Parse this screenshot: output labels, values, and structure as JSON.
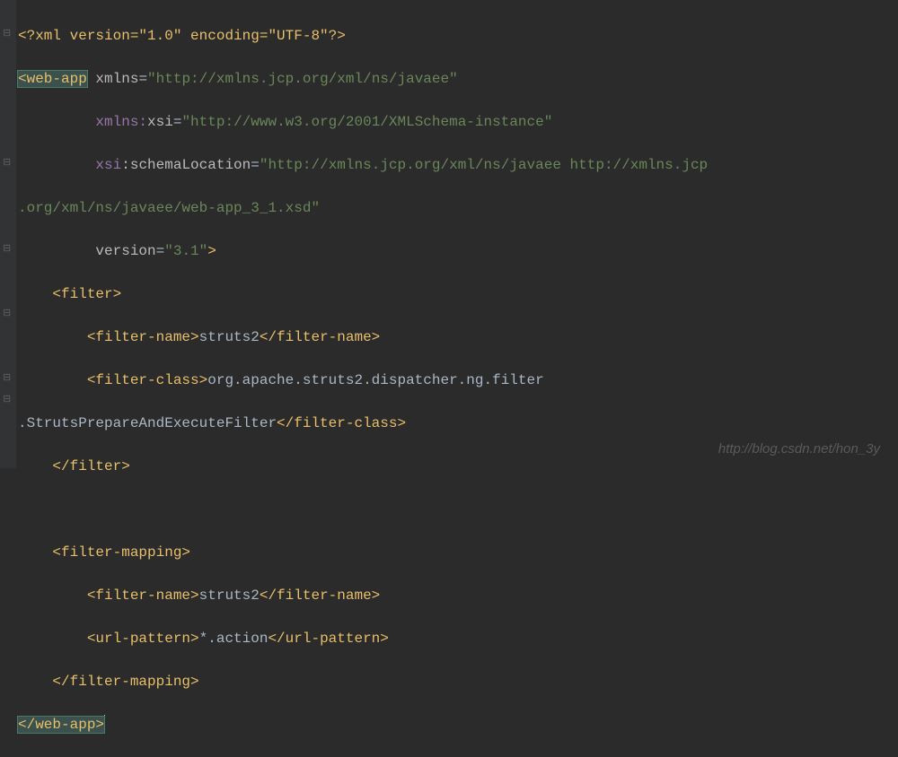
{
  "code": {
    "l1_decl": "<?xml version=\"1.0\" encoding=\"UTF-8\"?>",
    "l2_tag": "<web-app",
    "l2_attr1_name": "xmlns",
    "l2_attr1_val": "\"http://xmlns.jcp.org/xml/ns/javaee\"",
    "l3_attr_ns": "xmlns:",
    "l3_attr_local": "xsi",
    "l3_attr_val": "\"http://www.w3.org/2001/XMLSchema-instance\"",
    "l4_attr_ns": "xsi",
    "l4_attr_local": ":schemaLocation",
    "l4_attr_val_a": "\"http://xmlns.jcp.org/xml/ns/javaee http://xmlns.jcp",
    "l5_attr_val_b": ".org/xml/ns/javaee/web-app_3_1.xsd\"",
    "l6_attr_name": "version",
    "l6_attr_val": "\"3.1\"",
    "l6_close": ">",
    "l7_open": "<filter>",
    "l8_open": "<filter-name>",
    "l8_text": "struts2",
    "l8_close": "</filter-name>",
    "l9_open": "<filter-class>",
    "l9_text_a": "org.apache.struts2.dispatcher.ng.filter",
    "l10_text_b": ".StrutsPrepareAndExecuteFilter",
    "l10_close": "</filter-class>",
    "l11_close": "</filter>",
    "l13_open": "<filter-mapping>",
    "l14_open": "<filter-name>",
    "l14_text": "struts2",
    "l14_close": "</filter-name>",
    "l15_open": "<url-pattern>",
    "l15_text": "*.action",
    "l15_close": "</url-pattern>",
    "l16_close": "</filter-mapping>",
    "l17_close": "</web-app>"
  },
  "watermark": "http://blog.csdn.net/hon_3y"
}
